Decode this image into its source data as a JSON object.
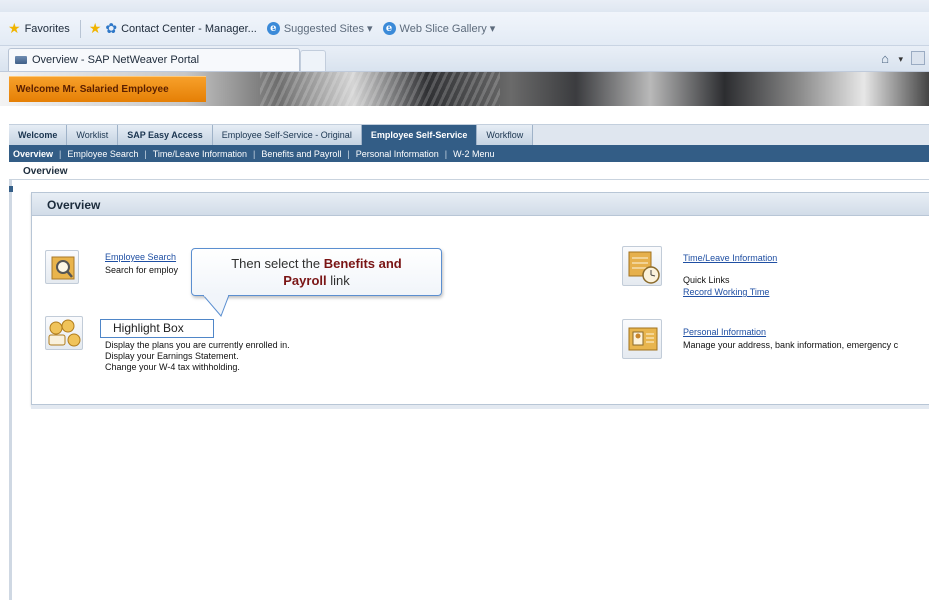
{
  "browser": {
    "favorites_label": "Favorites",
    "favorite_links": [
      "Contact Center - Manager...",
      "Suggested Sites ▾",
      "Web Slice Gallery ▾"
    ],
    "tab_title": "Overview - SAP NetWeaver Portal"
  },
  "sap": {
    "welcome": "Welcome Mr. Salaried Employee",
    "top_nav": [
      "Welcome",
      "Worklist",
      "SAP Easy Access",
      "Employee Self-Service - Original",
      "Employee Self-Service",
      "Workflow"
    ],
    "sub_nav": [
      "Overview",
      "Employee Search",
      "Time/Leave Information",
      "Benefits and Payroll",
      "Personal Information",
      "W-2 Menu"
    ],
    "breadcrumb": "Overview",
    "panel_title": "Overview"
  },
  "services": {
    "employee_search": {
      "link": "Employee Search",
      "desc": "Search for employ"
    },
    "benefits": {
      "desc_lines": [
        "Display the plans you are currently enrolled in.",
        "Display your Earnings Statement.",
        "Change your W-4 tax withholding."
      ]
    },
    "time_leave": {
      "link": "Time/Leave Information",
      "desc": "Quick Links",
      "sublink": "Record Working Time"
    },
    "personal": {
      "link": "Personal Information",
      "desc": "Manage your address, bank information, emergency c"
    }
  },
  "callout": {
    "prefix": "Then select the ",
    "bold1": "Benefits and",
    "bold2": "Payroll",
    "suffix": " link"
  },
  "highlight_label": "Highlight Box"
}
